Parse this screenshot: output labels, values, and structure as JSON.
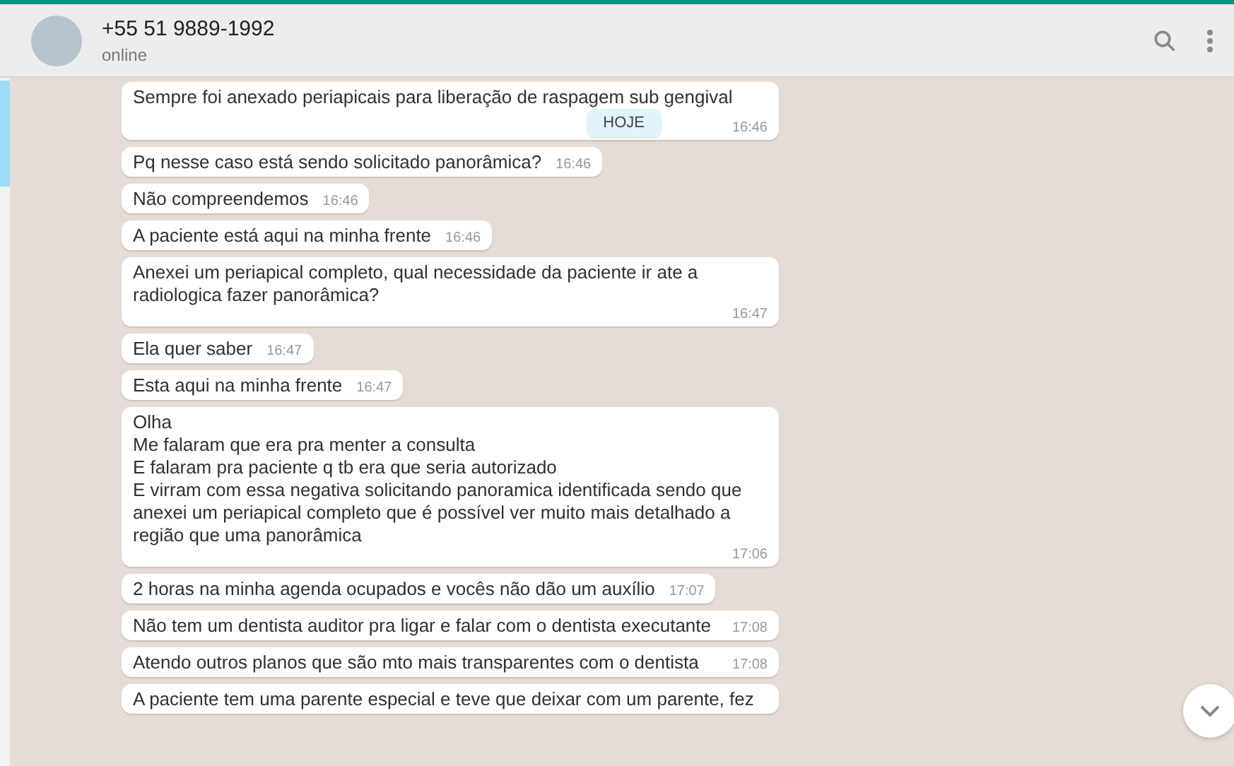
{
  "header": {
    "title": "+55 51 9889-1992",
    "status": "online"
  },
  "date_chip": "HOJE",
  "messages": [
    {
      "text": "Sempre foi anexado periapicais para liberação de raspagem sub gengival",
      "time": "16:46"
    },
    {
      "text": "Pq nesse caso está sendo solicitado panorâmica?",
      "time": "16:46"
    },
    {
      "text": "Não compreendemos",
      "time": "16:46"
    },
    {
      "text": "A paciente está aqui na minha frente",
      "time": "16:46"
    },
    {
      "text": "Anexei um periapical completo, qual necessidade da paciente ir ate a\nradiologica fazer panorâmica?",
      "time": "16:47"
    },
    {
      "text": "Ela quer saber",
      "time": "16:47"
    },
    {
      "text": "Esta aqui na minha frente",
      "time": "16:47"
    },
    {
      "text": "Olha\nMe falaram que era pra menter a consulta\nE falaram pra paciente q tb era que seria autorizado\nE virram com essa negativa solicitando panoramica identificada sendo que\nanexei um periapical completo que é possível ver muito mais detalhado a\nregião que uma panorâmica",
      "time": "17:06"
    },
    {
      "text": "2 horas na minha agenda ocupados e vocês não dão um auxílio",
      "time": "17:07"
    },
    {
      "text": "Não tem um dentista auditor pra ligar e falar com o dentista executante",
      "time": "17:08"
    },
    {
      "text": "Atendo outros planos que são mto mais transparentes com o dentista",
      "time": "17:08"
    },
    {
      "text": "A paciente tem uma parente especial e teve que deixar com um parente, fez"
    }
  ]
}
